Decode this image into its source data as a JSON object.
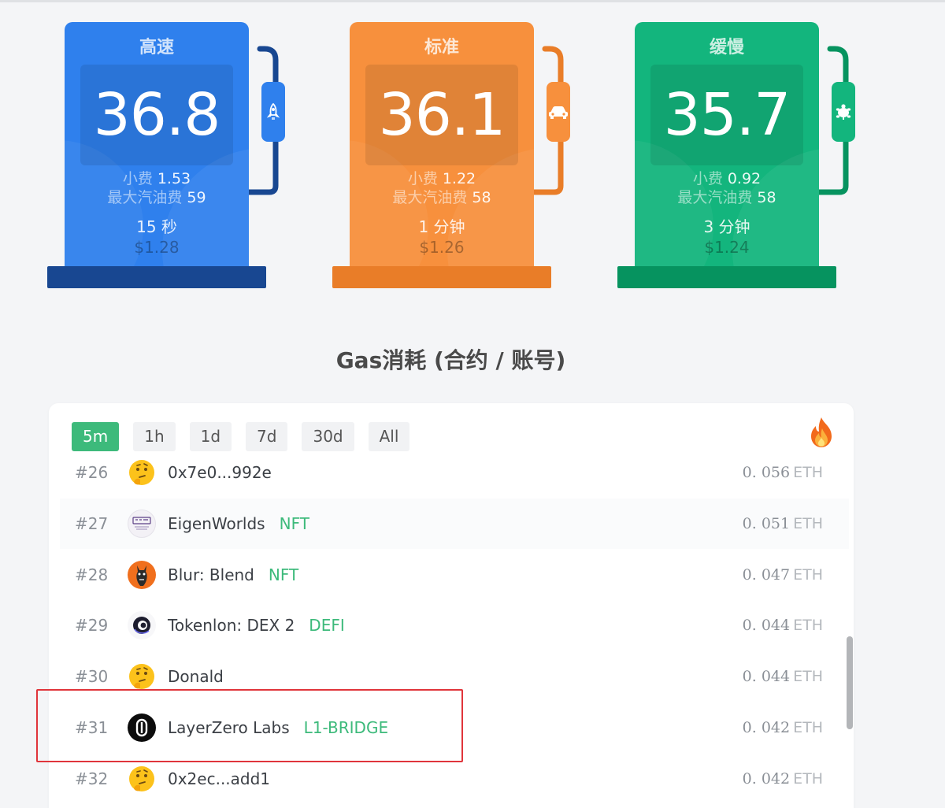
{
  "pumps": [
    {
      "title": "高速",
      "price": "36.8",
      "tip_label": "小费",
      "tip": "1.53",
      "max_label": "最大汽油费",
      "max": "59",
      "time": "15 秒",
      "usd": "$1.28",
      "icon": "rocket-icon"
    },
    {
      "title": "标准",
      "price": "36.1",
      "tip_label": "小费",
      "tip": "1.22",
      "max_label": "最大汽油费",
      "max": "58",
      "time": "1 分钟",
      "usd": "$1.26",
      "icon": "car-icon"
    },
    {
      "title": "缓慢",
      "price": "35.7",
      "tip_label": "小费",
      "tip": "0.92",
      "max_label": "最大汽油费",
      "max": "58",
      "time": "3 分钟",
      "usd": "$1.24",
      "icon": "turtle-icon"
    }
  ],
  "colors": {
    "fast": "#2f80ed",
    "standard": "#f7903d",
    "slow": "#13b57d",
    "accent": "#3dba7b",
    "highlight": "#e0353b"
  },
  "section_title": "Gas消耗 (合约 / 账号)",
  "tabs": [
    {
      "label": "5m",
      "active": true
    },
    {
      "label": "1h",
      "active": false
    },
    {
      "label": "1d",
      "active": false
    },
    {
      "label": "7d",
      "active": false
    },
    {
      "label": "30d",
      "active": false
    },
    {
      "label": "All",
      "active": false
    }
  ],
  "rows": [
    {
      "rank": "#26",
      "name": "0x7e0...992e",
      "tag": "",
      "amount": "0. 056",
      "unit": "ETH",
      "avatar": "thinking-emoji-icon"
    },
    {
      "rank": "#27",
      "name": "EigenWorlds",
      "tag": "NFT",
      "amount": "0. 051",
      "unit": "ETH",
      "avatar": "eigenworlds-logo-icon"
    },
    {
      "rank": "#28",
      "name": "Blur: Blend",
      "tag": "NFT",
      "amount": "0. 047",
      "unit": "ETH",
      "avatar": "blur-logo-icon"
    },
    {
      "rank": "#29",
      "name": "Tokenlon: DEX 2",
      "tag": "DEFI",
      "amount": "0. 044",
      "unit": "ETH",
      "avatar": "tokenlon-logo-icon"
    },
    {
      "rank": "#30",
      "name": "Donald",
      "tag": "",
      "amount": "0. 044",
      "unit": "ETH",
      "avatar": "thinking-emoji-icon"
    },
    {
      "rank": "#31",
      "name": "LayerZero Labs",
      "tag": "L1-BRIDGE",
      "amount": "0. 042",
      "unit": "ETH",
      "avatar": "layerzero-logo-icon"
    },
    {
      "rank": "#32",
      "name": "0x2ec...add1",
      "tag": "",
      "amount": "0. 042",
      "unit": "ETH",
      "avatar": "thinking-emoji-icon"
    }
  ]
}
